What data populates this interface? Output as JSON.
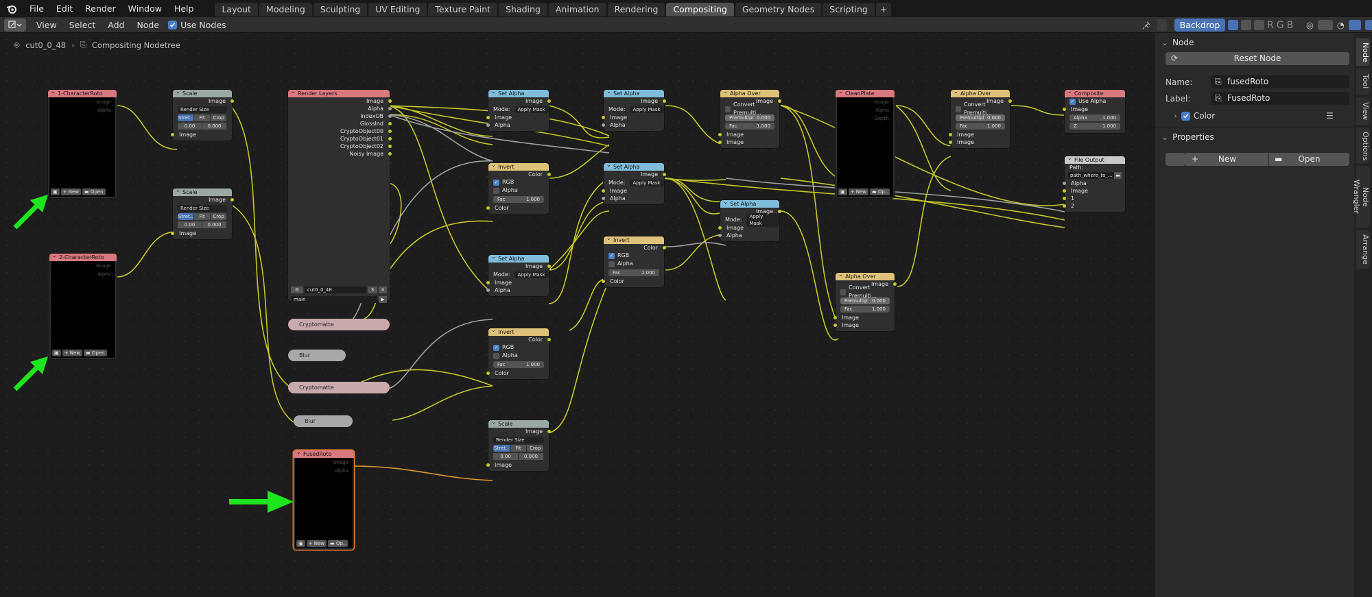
{
  "menus": [
    "File",
    "Edit",
    "Render",
    "Window",
    "Help"
  ],
  "workspaces": [
    "Layout",
    "Modeling",
    "Sculpting",
    "UV Editing",
    "Texture Paint",
    "Shading",
    "Animation",
    "Rendering",
    "Compositing",
    "Geometry Nodes",
    "Scripting",
    "+"
  ],
  "active_workspace": "Compositing",
  "header": {
    "items": [
      "View",
      "Select",
      "Add",
      "Node"
    ],
    "use_nodes": "Use Nodes",
    "backdrop": "Backdrop",
    "channels": [
      "R",
      "G",
      "B"
    ]
  },
  "breadcrumb": {
    "scene": "cut0_0_48",
    "tree": "Compositing Nodetree"
  },
  "nodes": {
    "char1": {
      "title": "1-CharacterRoto",
      "out1": "Image",
      "out2": "Alpha",
      "new": "New",
      "open": "Open"
    },
    "char2": {
      "title": "2-CharacterRoto",
      "out1": "Image",
      "out2": "Alpha",
      "new": "New",
      "open": "Open"
    },
    "scale1": {
      "title": "Scale",
      "out": "Image",
      "dd": "Render Size",
      "a": "Stret..",
      "b": "Fit",
      "c": "Crop",
      "x": "0.00",
      "y": "0.000",
      "in": "Image"
    },
    "scale2": {
      "title": "Scale",
      "out": "Image",
      "dd": "Render Size",
      "a": "Stret..",
      "b": "Fit",
      "c": "Crop",
      "x": "0.00",
      "y": "0.000",
      "in": "Image"
    },
    "scale3": {
      "title": "Scale",
      "out": "Image",
      "dd": "Render Size",
      "a": "Stret..",
      "b": "Fit",
      "c": "Crop",
      "x": "0.00",
      "y": "0.000",
      "in": "Image"
    },
    "render": {
      "title": "Render Layers",
      "outs": [
        "Image",
        "Alpha",
        "IndexOB",
        "GlossInd",
        "CryptoObject00",
        "CryptoObject01",
        "CryptoObject02",
        "Noisy Image"
      ],
      "scene": "cut0_0_48",
      "num": "3",
      "layer": "main"
    },
    "crypto1": {
      "title": "Cryptomatte"
    },
    "blur1": {
      "title": "Blur"
    },
    "crypto2": {
      "title": "Cryptomatte"
    },
    "blur2": {
      "title": "Blur"
    },
    "fused": {
      "title": "FusedRoto",
      "out1": "Image",
      "out2": "Alpha",
      "new": "New",
      "open": "Op.."
    },
    "sa1": {
      "title": "Set Alpha",
      "out": "Image",
      "mode": "Mode:",
      "modev": "Apply Mask",
      "in1": "Image",
      "in2": "Alpha"
    },
    "sa2": {
      "title": "Set Alpha",
      "out": "Image",
      "mode": "Mode:",
      "modev": "Apply Mask",
      "in1": "Image",
      "in2": "Alpha"
    },
    "sa3": {
      "title": "Set Alpha",
      "out": "Image",
      "mode": "Mode:",
      "modev": "Apply Mask",
      "in1": "Image",
      "in2": "Alpha"
    },
    "sa4": {
      "title": "Set Alpha",
      "out": "Image",
      "mode": "Mode:",
      "modev": "Apply Mask",
      "in1": "Image",
      "in2": "Alpha"
    },
    "sa5": {
      "title": "Set Alpha",
      "out": "Image",
      "mode": "Mode:",
      "modev": "Apply Mask",
      "in1": "Image",
      "in2": "Alpha"
    },
    "inv1": {
      "title": "Invert",
      "out": "Color",
      "rgb": "RGB",
      "alpha": "Alpha",
      "fac": "Fac",
      "facv": "1.000",
      "in": "Color"
    },
    "inv2": {
      "title": "Invert",
      "out": "Color",
      "rgb": "RGB",
      "alpha": "Alpha",
      "fac": "Fac",
      "facv": "1.000",
      "in": "Color"
    },
    "inv3": {
      "title": "Invert",
      "out": "Color",
      "rgb": "RGB",
      "alpha": "Alpha",
      "fac": "Fac",
      "facv": "1.000",
      "in": "Color"
    },
    "ao1": {
      "title": "Alpha Over",
      "out": "Image",
      "conv": "Convert Premulti...",
      "pre": "Premultipl",
      "prev": "0.000",
      "fac": "Fac",
      "facv": "1.000",
      "in1": "Image",
      "in2": "Image"
    },
    "ao2": {
      "title": "Alpha Over",
      "out": "Image",
      "conv": "Convert Premulti...",
      "pre": "Premultipl",
      "prev": "0.000",
      "fac": "Fac",
      "facv": "1.000",
      "in1": "Image",
      "in2": "Image"
    },
    "ao3": {
      "title": "Alpha Over",
      "out": "Image",
      "conv": "Convert Premulti...",
      "pre": "Premultip",
      "prev": "0.000",
      "fac": "Fac",
      "facv": "1.000",
      "in1": "Image",
      "in2": "Image"
    },
    "clean": {
      "title": "CleanPlate",
      "out1": "Image",
      "out2": "Alpha",
      "out3": "Depth",
      "new": "New",
      "open": "Op.."
    },
    "comp": {
      "title": "Composite",
      "usealpha": "Use Alpha",
      "in1": "Image",
      "alpha": "Alpha",
      "alphav": "1.000",
      "z": "Z",
      "zv": "1.000"
    },
    "fileout": {
      "title": "File Output",
      "path": "Path:",
      "pathv": "path_where_to_...",
      "in1": "Alpha",
      "in2": "Image",
      "in3": "1",
      "in4": "2"
    }
  },
  "sidebar": {
    "node_panel": "Node",
    "reset": "Reset Node",
    "name_label": "Name:",
    "name": "fusedRoto",
    "label_label": "Label:",
    "label": "FusedRoto",
    "color": "Color",
    "props_panel": "Properties",
    "new": "New",
    "open": "Open",
    "tabs": [
      "Node",
      "Tool",
      "View",
      "Options",
      "Node Wrangler",
      "Arrange"
    ]
  },
  "colors": {
    "accent": "#4772b3",
    "wire": "#c7c729",
    "wire_gray": "#a1a1a1",
    "arrow": "#1ee61e"
  }
}
